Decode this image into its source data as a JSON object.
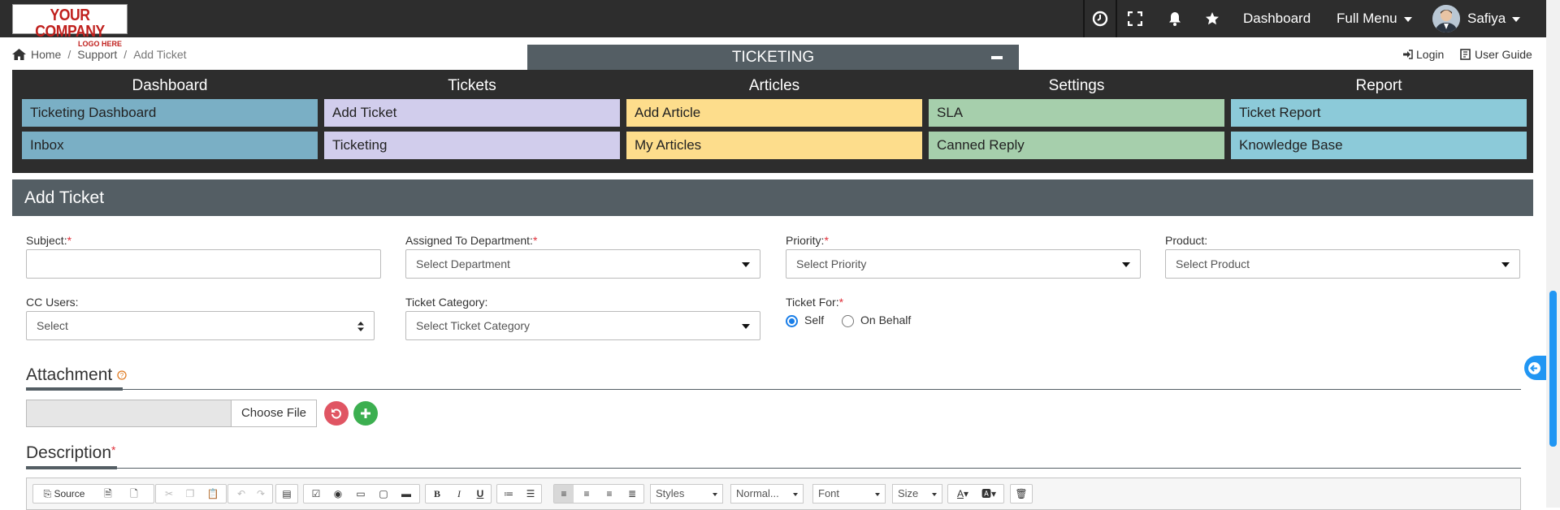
{
  "logo": {
    "line1": "YOUR COMPANY",
    "line2": "LOGO HERE"
  },
  "topnav": {
    "dashboard": "Dashboard",
    "full_menu": "Full Menu",
    "user": "Safiya",
    "icons": [
      "clock-icon",
      "fullscreen-icon",
      "bell-icon",
      "star-icon"
    ]
  },
  "breadcrumb": {
    "home": "Home",
    "support": "Support",
    "current": "Add Ticket"
  },
  "module_bar": {
    "title": "TICKETING"
  },
  "right_links": {
    "login": "Login",
    "user_guide": "User Guide"
  },
  "menu": {
    "columns": [
      {
        "head": "Dashboard",
        "items": [
          "Ticketing Dashboard",
          "Inbox"
        ],
        "color": "#7aafc5"
      },
      {
        "head": "Tickets",
        "items": [
          "Add Ticket",
          "Ticketing"
        ],
        "color": "#d1cdec"
      },
      {
        "head": "Articles",
        "items": [
          "Add Article",
          "My Articles"
        ],
        "color": "#fddd8c"
      },
      {
        "head": "Settings",
        "items": [
          "SLA",
          "Canned Reply"
        ],
        "color": "#a6cfac"
      },
      {
        "head": "Report",
        "items": [
          "Ticket Report",
          "Knowledge Base"
        ],
        "color": "#8ccad9"
      }
    ]
  },
  "form": {
    "title": "Add Ticket",
    "subject": {
      "label": "Subject:",
      "value": ""
    },
    "department": {
      "label": "Assigned To Department:",
      "placeholder": "Select Department"
    },
    "priority": {
      "label": "Priority:",
      "placeholder": "Select Priority"
    },
    "product": {
      "label": "Product:",
      "placeholder": "Select Product"
    },
    "cc_users": {
      "label": "CC Users:",
      "placeholder": "Select"
    },
    "category": {
      "label": "Ticket Category:",
      "placeholder": "Select Ticket Category"
    },
    "ticket_for": {
      "label": "Ticket For:",
      "options": [
        "Self",
        "On Behalf"
      ],
      "selected": "Self"
    },
    "required_mark": "*",
    "attachment": {
      "title": "Attachment",
      "button": "Choose File"
    },
    "description": {
      "title": "Description"
    }
  },
  "editor_toolbar": {
    "source": "Source",
    "styles": "Styles",
    "format": "Normal...",
    "font": "Font",
    "size": "Size"
  },
  "colors": {
    "topbar": "#2d2d2d",
    "panel": "#545e64",
    "accent": "#2196f3",
    "danger": "#e05563",
    "success": "#3caf50"
  }
}
